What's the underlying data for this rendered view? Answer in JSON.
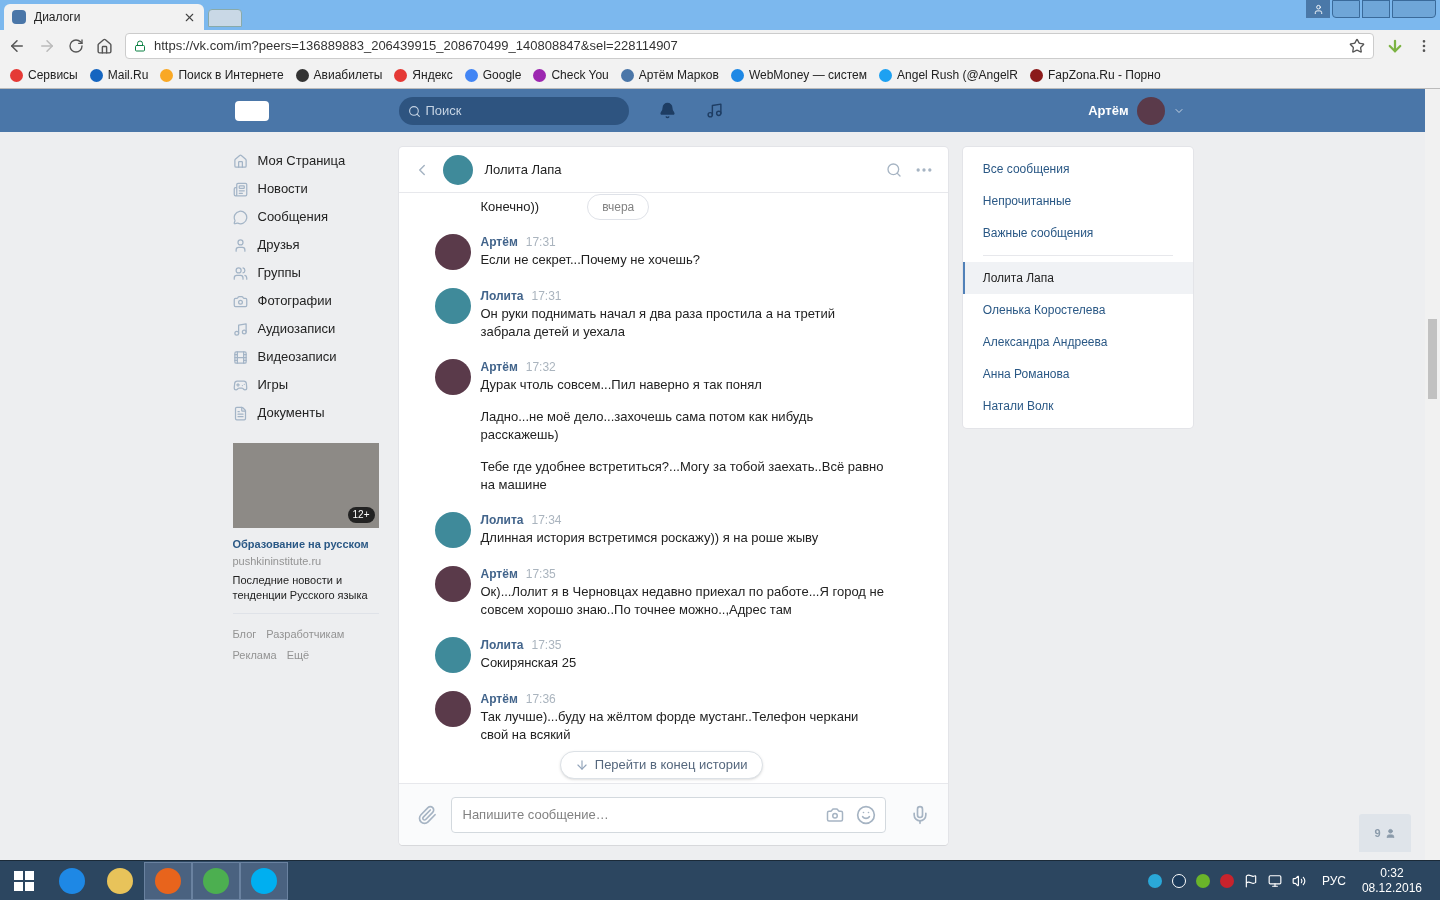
{
  "browser": {
    "tabs": [
      {
        "title": "Диалоги",
        "selected": true
      },
      {
        "selected": false
      }
    ],
    "url": "https://vk.com/im?peers=136889883_206439915_208670499_140808847&sel=228114907",
    "bookmarks": [
      "Сервисы",
      "Mail.Ru",
      "Поиск в Интернете",
      "Авиабилеты",
      "Яндекс",
      "Google",
      "Check You",
      "Артём Марков",
      "WebMoney — систем",
      "Angel Rush (@AngelR",
      "FapZona.Ru - Порно"
    ]
  },
  "header": {
    "search_placeholder": "Поиск",
    "user": "Артём"
  },
  "nav": [
    "Моя Страница",
    "Новости",
    "Сообщения",
    "Друзья",
    "Группы",
    "Фотографии",
    "Аудиозаписи",
    "Видеозаписи",
    "Игры",
    "Документы"
  ],
  "ad": {
    "age": "12+",
    "title": "Образование на русском",
    "domain": "pushkininstitute.ru",
    "text": "Последние новости и тенденции Русского языка"
  },
  "footer_links": [
    "Блог",
    "Разработчикам",
    "Реклама",
    "Ещё"
  ],
  "chat": {
    "name": "Лолита Лапа",
    "first": {
      "text": "Конечно))",
      "date": "вчера"
    },
    "messages": [
      {
        "author": "Артём",
        "kind": "me",
        "time": "17:31",
        "texts": [
          "Если не секрет...Почему не хочешь?"
        ]
      },
      {
        "author": "Лолита",
        "kind": "peer",
        "time": "17:31",
        "texts": [
          "Он руки поднимать начал я два раза простила а на третий забрала детей и уехала"
        ]
      },
      {
        "author": "Артём",
        "kind": "me",
        "time": "17:32",
        "texts": [
          "Дурак чтоль совсем...Пил наверно я так понял",
          "Ладно...не моё дело...захочешь сама потом как нибудь расскажешь)",
          "Тебе где удобнее встретиться?...Могу за тобой заехать..Всё равно на машине"
        ]
      },
      {
        "author": "Лолита",
        "kind": "peer",
        "time": "17:34",
        "texts": [
          "Длинная история встретимся роскажу)) я на роше жыву"
        ]
      },
      {
        "author": "Артём",
        "kind": "me",
        "time": "17:35",
        "texts": [
          "Ок)...Лолит я в Черновцах недавно приехал по работе...Я город не совсем хорошо знаю..По точнее можно..,Адрес там"
        ]
      },
      {
        "author": "Лолита",
        "kind": "peer",
        "time": "17:35",
        "texts": [
          "Сокирянская 25"
        ]
      },
      {
        "author": "Артём",
        "kind": "me",
        "time": "17:36",
        "texts": [
          "Так лучше)...буду на жёлтом форде мустанг..Телефон черкани свой на всякий"
        ]
      }
    ],
    "jump": "Перейти в конец истории",
    "composer_placeholder": "Напишите сообщение…"
  },
  "folders": [
    {
      "label": "Все сообщения",
      "selected": false
    },
    {
      "label": "Непрочитанные",
      "selected": false
    },
    {
      "label": "Важные сообщения",
      "selected": false
    }
  ],
  "dialogs": [
    {
      "label": "Лолита Лапа",
      "selected": true
    },
    {
      "label": "Оленька Коростелева",
      "selected": false
    },
    {
      "label": "Александра Андреева",
      "selected": false
    },
    {
      "label": "Анна Романова",
      "selected": false
    },
    {
      "label": "Натали Волк",
      "selected": false
    }
  ],
  "online_count": "9",
  "taskbar": {
    "lang": "РУС",
    "time": "0:32",
    "date": "08.12.2016"
  }
}
